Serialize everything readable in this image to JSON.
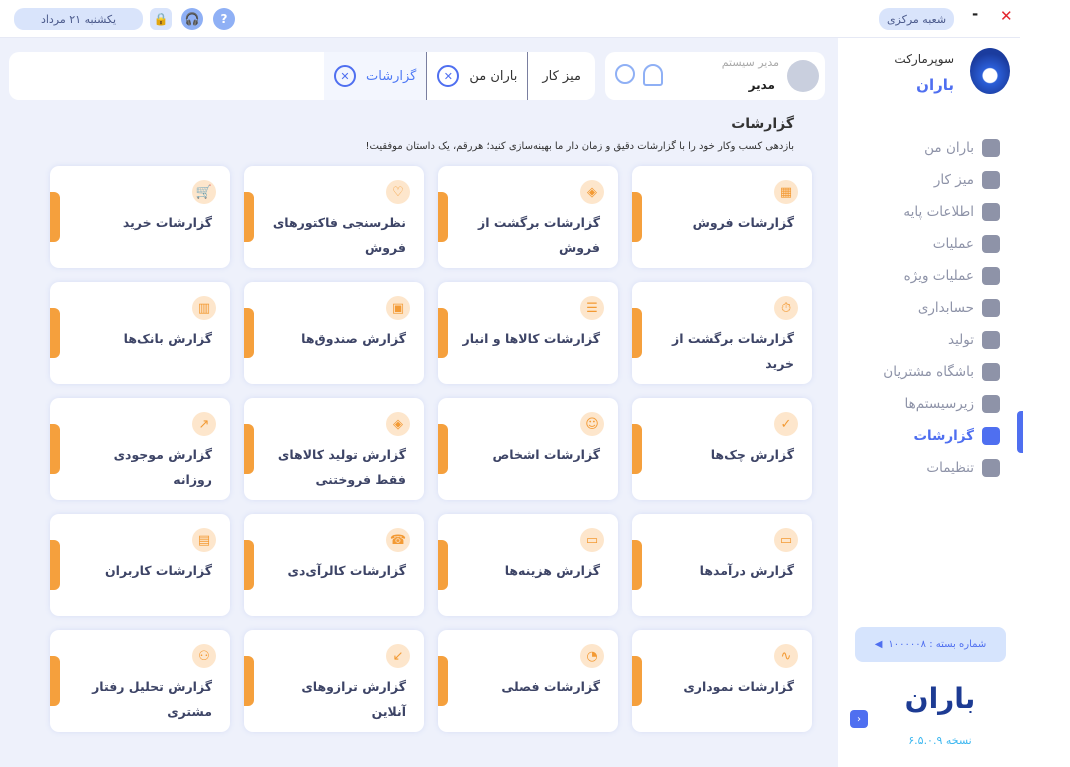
{
  "topbar": {
    "branch": "شعبه مرکزی",
    "date": "یکشنبه ۲۱ مرداد",
    "close_icon": "close-icon",
    "minimize_icon": "minimize-icon"
  },
  "tabs": [
    {
      "label": "میز کار"
    },
    {
      "label": "باران من",
      "closable": true
    },
    {
      "label": "گزارشات",
      "closable": true,
      "active": true
    }
  ],
  "user": {
    "role": "مدیر سیستم",
    "name": "مدیر"
  },
  "page": {
    "title": "گزارشات",
    "subtitle": "بازدهی کسب وکار خود را با گزارشات دقیق و زمان دار ما بهینه‌سازی کنید؛ هررقم، یک داستان موفقیت!"
  },
  "cards": [
    {
      "label": "گزارشات فروش",
      "icon": "store-icon"
    },
    {
      "label": "گزارشات برگشت از فروش",
      "icon": "box-icon"
    },
    {
      "label": "نظرسنجی فاکتورهای فروش",
      "icon": "heart-icon"
    },
    {
      "label": "گزارشات خرید",
      "icon": "cart-icon"
    },
    {
      "label": "گزارشات برگشت از خرید",
      "icon": "timer-icon"
    },
    {
      "label": "گزارشات کالاها و انبار",
      "icon": "clipboard-icon"
    },
    {
      "label": "گزارش صندوق‌ها",
      "icon": "cashbox-icon"
    },
    {
      "label": "گزارش بانک‌ها",
      "icon": "bank-icon"
    },
    {
      "label": "گزارش چک‌ها",
      "icon": "check-icon"
    },
    {
      "label": "گزارشات اشخاص",
      "icon": "person-icon"
    },
    {
      "label": "گزارش تولید کالاهای فقط فروختنی",
      "icon": "box-icon"
    },
    {
      "label": "گزارش موجودی روزانه",
      "icon": "trend-icon"
    },
    {
      "label": "گزارش درآمدها",
      "icon": "card-icon"
    },
    {
      "label": "گزارش هزینه‌ها",
      "icon": "card-icon"
    },
    {
      "label": "گزارشات کالرآی‌دی",
      "icon": "phone-icon"
    },
    {
      "label": "گزارشات کاربران",
      "icon": "id-card-icon"
    },
    {
      "label": "گزارشات نموداری",
      "icon": "chart-icon"
    },
    {
      "label": "گزارشات فصلی",
      "icon": "pie-icon"
    },
    {
      "label": "گزارش ترازوهای آنلاین",
      "icon": "arrow-icon"
    },
    {
      "label": "گزارش تحلیل رفتار مشتری",
      "icon": "users-icon"
    }
  ],
  "sidebar": {
    "brand_top": "سوپرمارکت",
    "brand_name": "باران",
    "items": [
      {
        "label": "باران من"
      },
      {
        "label": "میز کار"
      },
      {
        "label": "اطلاعات پایه"
      },
      {
        "label": "عملیات"
      },
      {
        "label": "عملیات ویژه"
      },
      {
        "label": "حسابداری"
      },
      {
        "label": "تولید"
      },
      {
        "label": "باشگاه مشتریان"
      },
      {
        "label": "زیرسیستم‌ها"
      },
      {
        "label": "گزارشات",
        "active": true
      },
      {
        "label": "تنظیمات"
      }
    ],
    "package": "شماره بسته : ۱۰۰۰۰۰۸",
    "logo": "باران",
    "version": "نسخه ۶.۵.۰.۹"
  },
  "colors": {
    "accent": "#4f6ff0",
    "card_accent": "#f5a03d",
    "bg": "#eef1fb"
  }
}
